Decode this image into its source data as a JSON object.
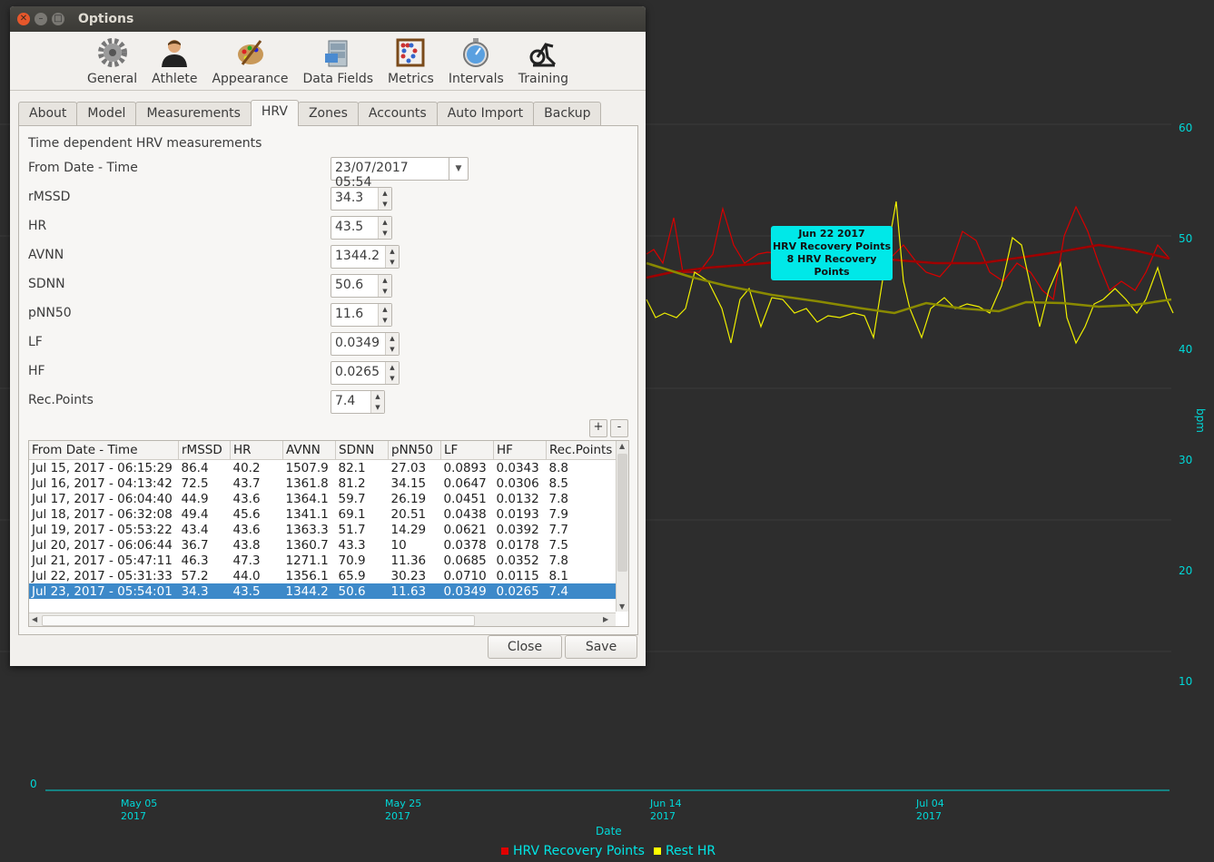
{
  "window": {
    "title": "Options"
  },
  "toolbar": [
    {
      "label": "General",
      "icon": "gear-icon"
    },
    {
      "label": "Athlete",
      "icon": "athlete-icon"
    },
    {
      "label": "Appearance",
      "icon": "palette-icon"
    },
    {
      "label": "Data Fields",
      "icon": "cabinet-icon"
    },
    {
      "label": "Metrics",
      "icon": "abacus-icon"
    },
    {
      "label": "Intervals",
      "icon": "stopwatch-icon"
    },
    {
      "label": "Training",
      "icon": "trainer-icon"
    }
  ],
  "tabs": [
    "About",
    "Model",
    "Measurements",
    "HRV",
    "Zones",
    "Accounts",
    "Auto Import",
    "Backup"
  ],
  "active_tab": "HRV",
  "form": {
    "heading": "Time dependent HRV measurements",
    "from_label": "From Date - Time",
    "from_value": "23/07/2017 05:54",
    "fields": [
      {
        "label": "rMSSD",
        "value": "34.3"
      },
      {
        "label": "HR",
        "value": "43.5"
      },
      {
        "label": "AVNN",
        "value": "1344.2"
      },
      {
        "label": "SDNN",
        "value": "50.6"
      },
      {
        "label": "pNN50",
        "value": "11.6"
      },
      {
        "label": "LF",
        "value": "0.0349"
      },
      {
        "label": "HF",
        "value": "0.0265"
      },
      {
        "label": "Rec.Points",
        "value": "7.4"
      }
    ],
    "add_label": "+",
    "remove_label": "-"
  },
  "table": {
    "headers": [
      "From Date - Time",
      "rMSSD",
      "HR",
      "AVNN",
      "SDNN",
      "pNN50",
      "LF",
      "HF",
      "Rec.Points"
    ],
    "rows": [
      [
        "Jul 15, 2017 - 06:15:29",
        "86.4",
        "40.2",
        "1507.9",
        "82.1",
        "27.03",
        "0.0893",
        "0.0343",
        "8.8"
      ],
      [
        "Jul 16, 2017 - 04:13:42",
        "72.5",
        "43.7",
        "1361.8",
        "81.2",
        "34.15",
        "0.0647",
        "0.0306",
        "8.5"
      ],
      [
        "Jul 17, 2017 - 06:04:40",
        "44.9",
        "43.6",
        "1364.1",
        "59.7",
        "26.19",
        "0.0451",
        "0.0132",
        "7.8"
      ],
      [
        "Jul 18, 2017 - 06:32:08",
        "49.4",
        "45.6",
        "1341.1",
        "69.1",
        "20.51",
        "0.0438",
        "0.0193",
        "7.9"
      ],
      [
        "Jul 19, 2017 - 05:53:22",
        "43.4",
        "43.6",
        "1363.3",
        "51.7",
        "14.29",
        "0.0621",
        "0.0392",
        "7.7"
      ],
      [
        "Jul 20, 2017 - 06:06:44",
        "36.7",
        "43.8",
        "1360.7",
        "43.3",
        "10",
        "0.0378",
        "0.0178",
        "7.5"
      ],
      [
        "Jul 21, 2017 - 05:47:11",
        "46.3",
        "47.3",
        "1271.1",
        "70.9",
        "11.36",
        "0.0685",
        "0.0352",
        "7.8"
      ],
      [
        "Jul 22, 2017 - 05:31:33",
        "57.2",
        "44.0",
        "1356.1",
        "65.9",
        "30.23",
        "0.0710",
        "0.0115",
        "8.1"
      ],
      [
        "Jul 23, 2017 - 05:54:01",
        "34.3",
        "43.5",
        "1344.2",
        "50.6",
        "11.63",
        "0.0349",
        "0.0265",
        "7.4"
      ]
    ],
    "selected_row": 8
  },
  "buttons": {
    "close": "Close",
    "save": "Save"
  },
  "chart_data": {
    "type": "line",
    "xlabel": "Date",
    "ylabel": "bpm",
    "ylim": [
      0,
      60
    ],
    "y_ticks": [
      "60",
      "50",
      "40",
      "30",
      "20",
      "10"
    ],
    "y_zero": "0",
    "x_ticks": [
      {
        "month": "May 05",
        "year": "2017"
      },
      {
        "month": "May 25",
        "year": "2017"
      },
      {
        "month": "Jun 14",
        "year": "2017"
      },
      {
        "month": "Jul 04",
        "year": "2017"
      }
    ],
    "series": [
      {
        "name": "HRV Recovery Points",
        "color": "#e00000"
      },
      {
        "name": "Rest HR",
        "color": "#ffff00"
      }
    ],
    "tooltip": [
      "Jun 22 2017",
      "HRV Recovery Points",
      "8 HRV Recovery Points"
    ]
  }
}
